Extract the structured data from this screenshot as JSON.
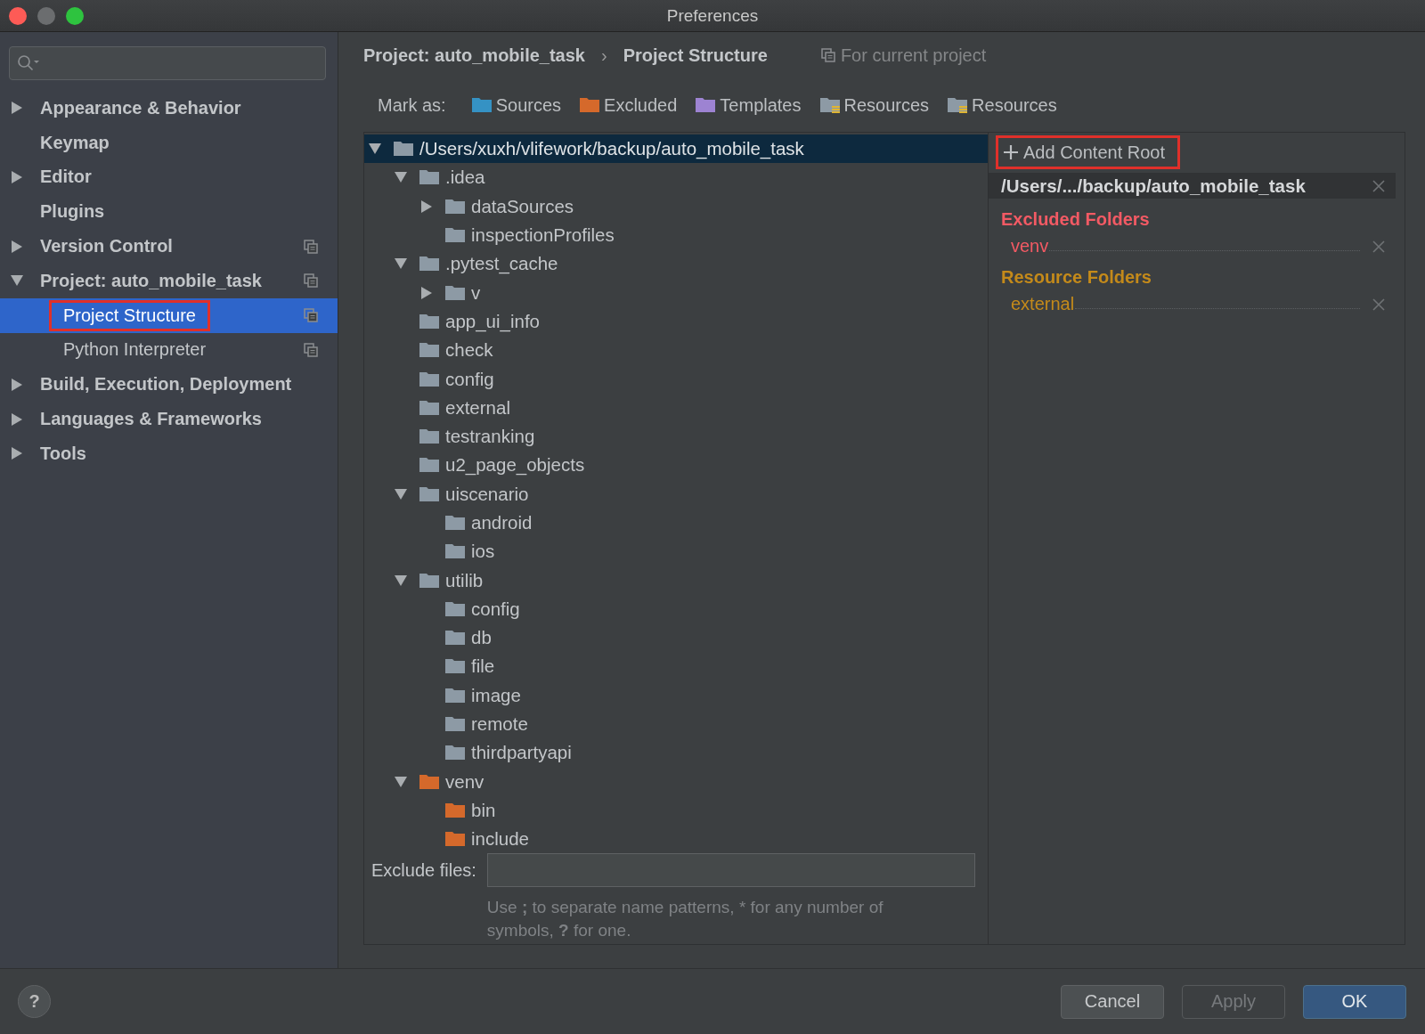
{
  "window": {
    "title": "Preferences"
  },
  "sidebar": {
    "items": [
      {
        "label": "Appearance & Behavior",
        "expanded": false,
        "selected": false,
        "project_scoped": false
      },
      {
        "label": "Keymap",
        "selected": false,
        "project_scoped": false
      },
      {
        "label": "Editor",
        "expanded": false,
        "selected": false,
        "project_scoped": false
      },
      {
        "label": "Plugins",
        "selected": false,
        "project_scoped": false
      },
      {
        "label": "Version Control",
        "expanded": false,
        "selected": false,
        "project_scoped": true
      },
      {
        "label": "Project: auto_mobile_task",
        "expanded": true,
        "selected": false,
        "project_scoped": true,
        "children": [
          {
            "label": "Project Structure",
            "selected": true,
            "project_scoped": true,
            "highlighted": true
          },
          {
            "label": "Python Interpreter",
            "selected": false,
            "project_scoped": true,
            "highlighted": false
          }
        ]
      },
      {
        "label": "Build, Execution, Deployment",
        "expanded": false,
        "selected": false,
        "project_scoped": false
      },
      {
        "label": "Languages & Frameworks",
        "expanded": false,
        "selected": false,
        "project_scoped": false
      },
      {
        "label": "Tools",
        "expanded": false,
        "selected": false,
        "project_scoped": false
      }
    ]
  },
  "breadcrumb": {
    "items": [
      "Project: auto_mobile_task",
      "Project Structure"
    ],
    "separator": "›",
    "scope_note": "For current project"
  },
  "mark_as": {
    "label": "Mark as:",
    "buttons": [
      {
        "label": "Sources",
        "kind": "sources"
      },
      {
        "label": "Excluded",
        "kind": "excluded"
      },
      {
        "label": "Templates",
        "kind": "templates"
      },
      {
        "label": "Resources",
        "kind": "resources"
      },
      {
        "label": "Resources",
        "kind": "test_resources"
      }
    ]
  },
  "tree": [
    {
      "name": "/Users/xuxh/vlifework/backup/auto_mobile_task",
      "expanded": true,
      "selected": true,
      "excluded": false,
      "children": [
        {
          "name": ".idea",
          "expanded": true,
          "selected": false,
          "excluded": false,
          "children": [
            {
              "name": "dataSources",
              "expanded": false,
              "selected": false,
              "excluded": false
            },
            {
              "name": "inspectionProfiles",
              "selected": false,
              "excluded": false
            }
          ]
        },
        {
          "name": ".pytest_cache",
          "expanded": true,
          "selected": false,
          "excluded": false,
          "children": [
            {
              "name": "v",
              "expanded": false,
              "selected": false,
              "excluded": false
            }
          ]
        },
        {
          "name": "app_ui_info",
          "selected": false,
          "excluded": false
        },
        {
          "name": "check",
          "selected": false,
          "excluded": false
        },
        {
          "name": "config",
          "selected": false,
          "excluded": false
        },
        {
          "name": "external",
          "selected": false,
          "excluded": false
        },
        {
          "name": "testranking",
          "selected": false,
          "excluded": false
        },
        {
          "name": "u2_page_objects",
          "selected": false,
          "excluded": false
        },
        {
          "name": "uiscenario",
          "expanded": true,
          "selected": false,
          "excluded": false,
          "children": [
            {
              "name": "android",
              "selected": false,
              "excluded": false
            },
            {
              "name": "ios",
              "selected": false,
              "excluded": false
            }
          ]
        },
        {
          "name": "utilib",
          "expanded": true,
          "selected": false,
          "excluded": false,
          "children": [
            {
              "name": "config",
              "selected": false,
              "excluded": false
            },
            {
              "name": "db",
              "selected": false,
              "excluded": false
            },
            {
              "name": "file",
              "selected": false,
              "excluded": false
            },
            {
              "name": "image",
              "selected": false,
              "excluded": false
            },
            {
              "name": "remote",
              "selected": false,
              "excluded": false
            },
            {
              "name": "thirdpartyapi",
              "selected": false,
              "excluded": false
            }
          ]
        },
        {
          "name": "venv",
          "expanded": true,
          "selected": false,
          "excluded": true,
          "children": [
            {
              "name": "bin",
              "selected": false,
              "excluded": true
            },
            {
              "name": "include",
              "selected": false,
              "excluded": true
            }
          ]
        }
      ]
    }
  ],
  "exclude_files": {
    "label": "Exclude files:",
    "hint": "Use **;** to separate name patterns, * for any number of symbols, **?** for one."
  },
  "content_roots": {
    "add_button": {
      "label": "Add Content Root",
      "highlighted": true
    },
    "roots": [
      {
        "path": "/Users/.../backup/auto_mobile_task",
        "sections": [
          {
            "title": "Excluded Folders",
            "color": "#f35a64",
            "folders": [
              "venv"
            ]
          },
          {
            "title": "Resource Folders",
            "color": "#c48a1a",
            "folders": [
              "external"
            ]
          }
        ]
      }
    ]
  },
  "footer": {
    "help": "?",
    "buttons": [
      {
        "label": "Cancel",
        "kind": "default",
        "disabled": false
      },
      {
        "label": "Apply",
        "kind": "default",
        "disabled": true
      },
      {
        "label": "OK",
        "kind": "primary",
        "disabled": false
      }
    ]
  }
}
